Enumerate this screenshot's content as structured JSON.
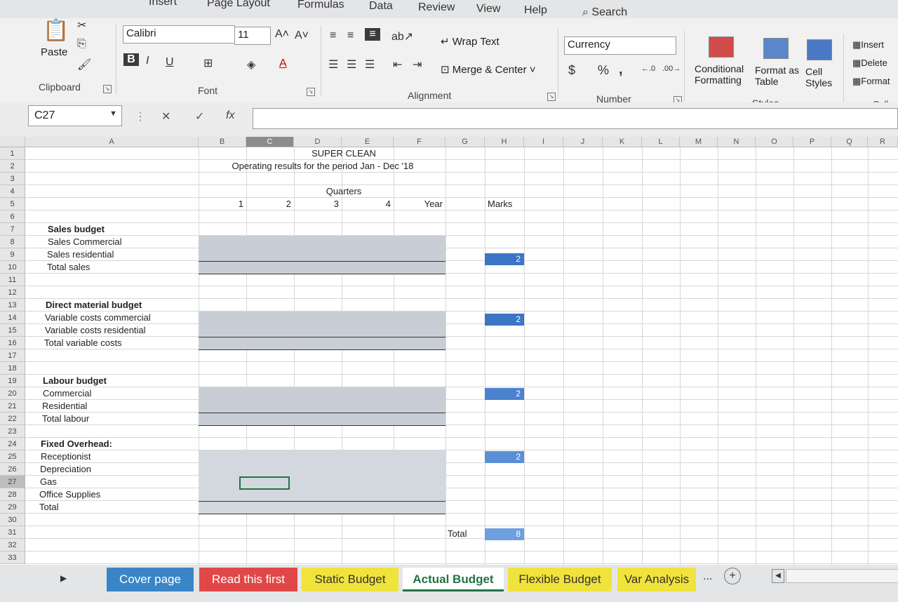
{
  "ribbon_tabs": [
    "Insert",
    "Page Layout",
    "Formulas",
    "Data",
    "Review",
    "View",
    "Help"
  ],
  "search": {
    "label": "Search"
  },
  "clipboard": {
    "paste": "Paste",
    "label": "Clipboard"
  },
  "font": {
    "name": "Calibri",
    "size": "11",
    "label": "Font",
    "bold": "B",
    "italic": "I",
    "underline": "U"
  },
  "alignment": {
    "wrap": "Wrap Text",
    "merge": "Merge & Center",
    "label": "Alignment"
  },
  "number": {
    "format": "Currency",
    "currency": "$",
    "percent": "%",
    "comma": ",",
    "label": "Number"
  },
  "styles": {
    "conditional_1": "Conditional",
    "conditional_2": "Formatting",
    "format_table_1": "Format as",
    "format_table_2": "Table",
    "cell_styles_1": "Cell",
    "cell_styles_2": "Styles",
    "label": "Styles"
  },
  "cells": {
    "insert": "Insert",
    "delete": "Delete",
    "format": "Format",
    "label": "Cells"
  },
  "formula_bar": {
    "name_box": "C27",
    "cancel": "✕",
    "enter": "✓",
    "fx": "fx",
    "value": ""
  },
  "columns": [
    "A",
    "B",
    "C",
    "D",
    "E",
    "F",
    "G",
    "H",
    "I",
    "J",
    "K",
    "L",
    "M",
    "N",
    "O",
    "P",
    "Q",
    "R"
  ],
  "rows": [
    "1",
    "2",
    "3",
    "4",
    "5",
    "6",
    "7",
    "8",
    "9",
    "10",
    "11",
    "12",
    "13",
    "14",
    "15",
    "16",
    "17",
    "18",
    "19",
    "20",
    "21",
    "22",
    "23",
    "24",
    "25",
    "26",
    "27",
    "28",
    "29",
    "30",
    "31",
    "32",
    "33"
  ],
  "sheet": {
    "title": "SUPER CLEAN",
    "subtitle": "Operating results for the period Jan - Dec '18",
    "quarters": "Quarters",
    "q1": "1",
    "q2": "2",
    "q3": "3",
    "q4": "4",
    "year": "Year",
    "marks": "Marks",
    "sales_budget": "Sales budget",
    "sales_commercial": "Sales Commercial",
    "sales_residential": "Sales residential",
    "total_sales": "Total sales",
    "direct_material": "Direct material budget",
    "var_commercial": "Variable costs commercial",
    "var_residential": "Variable costs residential",
    "total_variable": "Total variable costs",
    "labour_budget": "Labour budget",
    "commercial": "Commercial",
    "residential": "Residential",
    "total_labour": "Total labour",
    "fixed_overhead": "Fixed Overhead:",
    "receptionist": "Receptionist",
    "depreciation": "Depreciation",
    "gas": "Gas",
    "office_supplies": "Office Supplies",
    "total": "Total",
    "total_label": "Total",
    "mark_sales": "2",
    "mark_material": "2",
    "mark_labour": "2",
    "mark_fixed": "2",
    "mark_total": "8"
  },
  "sheet_tabs": [
    {
      "label": "Cover page",
      "color": "#3a85c8"
    },
    {
      "label": "Read this first",
      "color": "#e04848"
    },
    {
      "label": "Static Budget",
      "color": "#f0e33c"
    },
    {
      "label": "Actual Budget",
      "color": "#ffffff"
    },
    {
      "label": "Flexible Budget",
      "color": "#f0e33c"
    },
    {
      "label": "Var Analysis",
      "color": "#f0e33c"
    }
  ],
  "more_tabs": "...",
  "add_sheet": "+"
}
